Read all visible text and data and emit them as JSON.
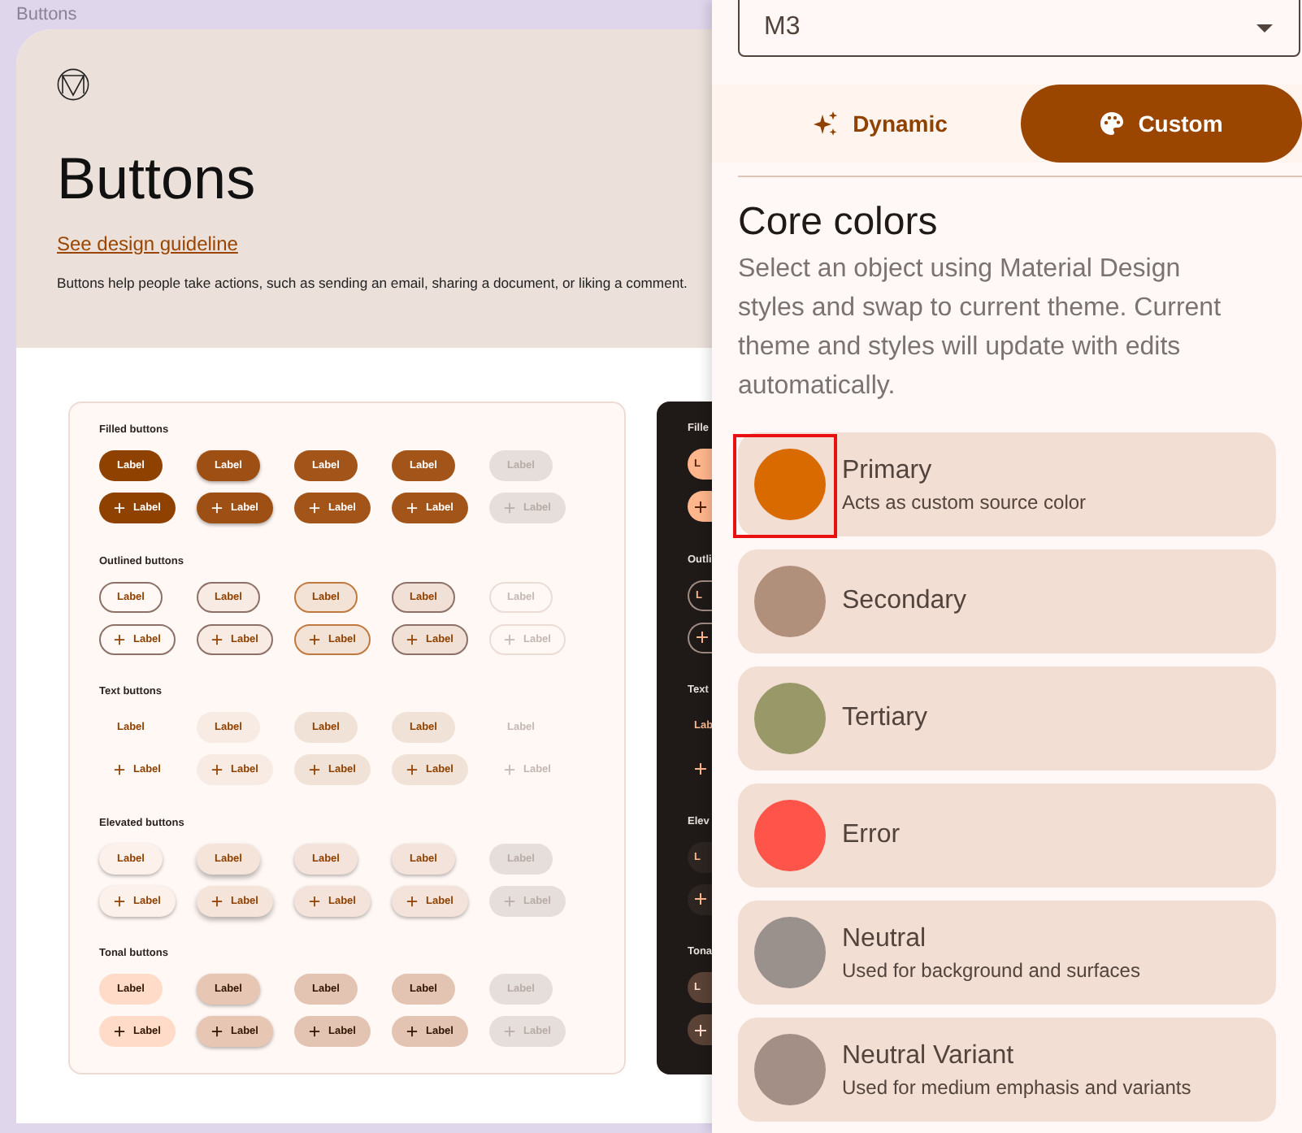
{
  "canvas_label": "Buttons",
  "header": {
    "title": "Buttons",
    "link": "See design guideline",
    "description": "Buttons help people take actions, such as sending an email, sharing a document, or liking a comment."
  },
  "light_sections": [
    {
      "title": "Filled buttons",
      "kind": "filled",
      "rows": [
        {
          "icon": false,
          "buttons": [
            {
              "label": "Label",
              "kind": "enabled"
            },
            {
              "label": "Label",
              "kind": "hovered"
            },
            {
              "label": "Label",
              "kind": "focused"
            },
            {
              "label": "Label",
              "kind": "pressed"
            },
            {
              "label": "Label",
              "kind": "disabled"
            }
          ]
        },
        {
          "icon": true,
          "buttons": [
            {
              "label": "Label",
              "kind": "enabled"
            },
            {
              "label": "Label",
              "kind": "hovered"
            },
            {
              "label": "Label",
              "kind": "focused"
            },
            {
              "label": "Label",
              "kind": "pressed"
            },
            {
              "label": "Label",
              "kind": "disabled"
            }
          ]
        }
      ]
    },
    {
      "title": "Outlined buttons",
      "kind": "outlined",
      "rows": [
        {
          "icon": false,
          "buttons": [
            {
              "label": "Label",
              "kind": "enabled"
            },
            {
              "label": "Label",
              "kind": "hovered"
            },
            {
              "label": "Label",
              "kind": "focused"
            },
            {
              "label": "Label",
              "kind": "pressed"
            },
            {
              "label": "Label",
              "kind": "disabled"
            }
          ]
        },
        {
          "icon": true,
          "buttons": [
            {
              "label": "Label",
              "kind": "enabled"
            },
            {
              "label": "Label",
              "kind": "hovered"
            },
            {
              "label": "Label",
              "kind": "focused"
            },
            {
              "label": "Label",
              "kind": "pressed"
            },
            {
              "label": "Label",
              "kind": "disabled"
            }
          ]
        }
      ]
    },
    {
      "title": "Text buttons",
      "kind": "text",
      "rows": [
        {
          "icon": false,
          "buttons": [
            {
              "label": "Label",
              "kind": "enabled"
            },
            {
              "label": "Label",
              "kind": "hovered"
            },
            {
              "label": "Label",
              "kind": "focused"
            },
            {
              "label": "Label",
              "kind": "pressed"
            },
            {
              "label": "Label",
              "kind": "disabled"
            }
          ]
        },
        {
          "icon": true,
          "buttons": [
            {
              "label": "Label",
              "kind": "enabled"
            },
            {
              "label": "Label",
              "kind": "hovered"
            },
            {
              "label": "Label",
              "kind": "focused"
            },
            {
              "label": "Label",
              "kind": "pressed"
            },
            {
              "label": "Label",
              "kind": "disabled"
            }
          ]
        }
      ]
    },
    {
      "title": "Elevated buttons",
      "kind": "elevated",
      "rows": [
        {
          "icon": false,
          "buttons": [
            {
              "label": "Label",
              "kind": "enabled"
            },
            {
              "label": "Label",
              "kind": "hovered"
            },
            {
              "label": "Label",
              "kind": "focused"
            },
            {
              "label": "Label",
              "kind": "pressed"
            },
            {
              "label": "Label",
              "kind": "disabled"
            }
          ]
        },
        {
          "icon": true,
          "buttons": [
            {
              "label": "Label",
              "kind": "enabled"
            },
            {
              "label": "Label",
              "kind": "hovered"
            },
            {
              "label": "Label",
              "kind": "focused"
            },
            {
              "label": "Label",
              "kind": "pressed"
            },
            {
              "label": "Label",
              "kind": "disabled"
            }
          ]
        }
      ]
    },
    {
      "title": "Tonal buttons",
      "kind": "tonal",
      "rows": [
        {
          "icon": false,
          "buttons": [
            {
              "label": "Label",
              "kind": "enabled"
            },
            {
              "label": "Label",
              "kind": "hovered"
            },
            {
              "label": "Label",
              "kind": "focused"
            },
            {
              "label": "Label",
              "kind": "pressed"
            },
            {
              "label": "Label",
              "kind": "disabled"
            }
          ]
        },
        {
          "icon": true,
          "buttons": [
            {
              "label": "Label",
              "kind": "enabled"
            },
            {
              "label": "Label",
              "kind": "hovered"
            },
            {
              "label": "Label",
              "kind": "focused"
            },
            {
              "label": "Label",
              "kind": "pressed"
            },
            {
              "label": "Label",
              "kind": "disabled"
            }
          ]
        }
      ]
    }
  ],
  "dark_sections": [
    {
      "title": "Fille",
      "kind": "filled",
      "rows": [
        {
          "icon": false,
          "label": "L"
        },
        {
          "icon": true
        }
      ]
    },
    {
      "title": "Outli",
      "kind": "outlined",
      "rows": [
        {
          "icon": false,
          "label": "L"
        },
        {
          "icon": true
        }
      ]
    },
    {
      "title": "Text",
      "kind": "text",
      "rows": [
        {
          "icon": false,
          "label": "Lab"
        },
        {
          "icon": true
        }
      ]
    },
    {
      "title": "Elev",
      "kind": "elevated",
      "rows": [
        {
          "icon": false,
          "label": "L"
        },
        {
          "icon": true
        }
      ]
    },
    {
      "title": "Tona",
      "kind": "tonal",
      "rows": [
        {
          "icon": false,
          "label": "L"
        },
        {
          "icon": true
        }
      ]
    }
  ],
  "panel": {
    "dropdown": {
      "value": "M3"
    },
    "tabs": [
      {
        "label": "Dynamic",
        "selected": false
      },
      {
        "label": "Custom",
        "selected": true
      }
    ],
    "title": "Core colors",
    "description": "Select an object using Material Design styles and swap to current theme. Current theme and styles will update with edits automatically.",
    "colors": [
      {
        "name": "Primary",
        "subtitle": "Acts as custom source color",
        "color": "#d96a00",
        "selected": true
      },
      {
        "name": "Secondary",
        "color": "#b08f7b",
        "selected": false
      },
      {
        "name": "Tertiary",
        "color": "#989868",
        "selected": false
      },
      {
        "name": "Error",
        "color": "#ff5449",
        "selected": false
      },
      {
        "name": "Neutral",
        "subtitle": "Used for background and surfaces",
        "color": "#9a918d",
        "selected": false
      },
      {
        "name": "Neutral Variant",
        "subtitle": "Used for medium emphasis and variants",
        "color": "#a38f86",
        "selected": false
      }
    ]
  }
}
